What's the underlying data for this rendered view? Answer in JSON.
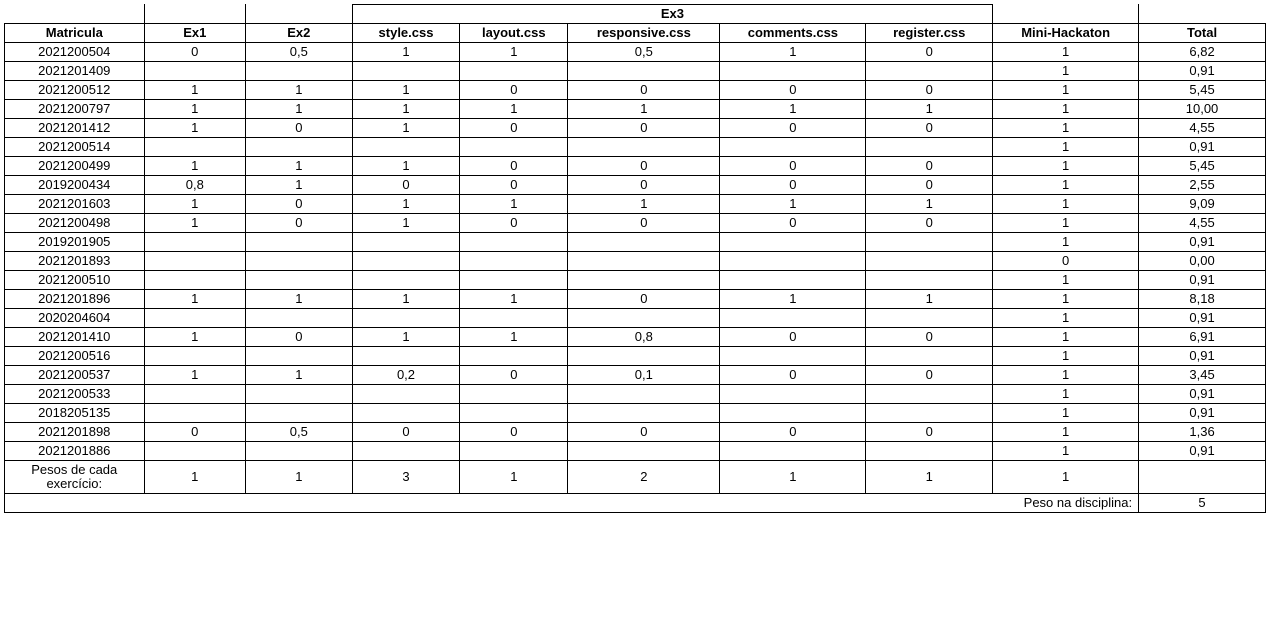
{
  "headers": {
    "group": "Ex3",
    "cols": [
      "Matricula",
      "Ex1",
      "Ex2",
      "style.css",
      "layout.css",
      "responsive.css",
      "comments.css",
      "register.css",
      "Mini-Hackaton",
      "Total"
    ]
  },
  "rows": [
    {
      "m": "2021200504",
      "v": [
        "0",
        "0,5",
        "1",
        "1",
        "0,5",
        "1",
        "0",
        "1",
        "6,82"
      ]
    },
    {
      "m": "2021201409",
      "v": [
        "",
        "",
        "",
        "",
        "",
        "",
        "",
        "1",
        "0,91"
      ]
    },
    {
      "m": "2021200512",
      "v": [
        "1",
        "1",
        "1",
        "0",
        "0",
        "0",
        "0",
        "1",
        "5,45"
      ]
    },
    {
      "m": "2021200797",
      "v": [
        "1",
        "1",
        "1",
        "1",
        "1",
        "1",
        "1",
        "1",
        "10,00"
      ]
    },
    {
      "m": "2021201412",
      "v": [
        "1",
        "0",
        "1",
        "0",
        "0",
        "0",
        "0",
        "1",
        "4,55"
      ]
    },
    {
      "m": "2021200514",
      "v": [
        "",
        "",
        "",
        "",
        "",
        "",
        "",
        "1",
        "0,91"
      ]
    },
    {
      "m": "2021200499",
      "v": [
        "1",
        "1",
        "1",
        "0",
        "0",
        "0",
        "0",
        "1",
        "5,45"
      ]
    },
    {
      "m": "2019200434",
      "v": [
        "0,8",
        "1",
        "0",
        "0",
        "0",
        "0",
        "0",
        "1",
        "2,55"
      ]
    },
    {
      "m": "2021201603",
      "v": [
        "1",
        "0",
        "1",
        "1",
        "1",
        "1",
        "1",
        "1",
        "9,09"
      ]
    },
    {
      "m": "2021200498",
      "v": [
        "1",
        "0",
        "1",
        "0",
        "0",
        "0",
        "0",
        "1",
        "4,55"
      ]
    },
    {
      "m": "2019201905",
      "v": [
        "",
        "",
        "",
        "",
        "",
        "",
        "",
        "1",
        "0,91"
      ]
    },
    {
      "m": "2021201893",
      "v": [
        "",
        "",
        "",
        "",
        "",
        "",
        "",
        "0",
        "0,00"
      ]
    },
    {
      "m": "2021200510",
      "v": [
        "",
        "",
        "",
        "",
        "",
        "",
        "",
        "1",
        "0,91"
      ]
    },
    {
      "m": "2021201896",
      "v": [
        "1",
        "1",
        "1",
        "1",
        "0",
        "1",
        "1",
        "1",
        "8,18"
      ]
    },
    {
      "m": "2020204604",
      "v": [
        "",
        "",
        "",
        "",
        "",
        "",
        "",
        "1",
        "0,91"
      ]
    },
    {
      "m": "2021201410",
      "v": [
        "1",
        "0",
        "1",
        "1",
        "0,8",
        "0",
        "0",
        "1",
        "6,91"
      ]
    },
    {
      "m": "2021200516",
      "v": [
        "",
        "",
        "",
        "",
        "",
        "",
        "",
        "1",
        "0,91"
      ]
    },
    {
      "m": "2021200537",
      "v": [
        "1",
        "1",
        "0,2",
        "0",
        "0,1",
        "0",
        "0",
        "1",
        "3,45"
      ]
    },
    {
      "m": "2021200533",
      "v": [
        "",
        "",
        "",
        "",
        "",
        "",
        "",
        "1",
        "0,91"
      ]
    },
    {
      "m": "2018205135",
      "v": [
        "",
        "",
        "",
        "",
        "",
        "",
        "",
        "1",
        "0,91"
      ]
    },
    {
      "m": "2021201898",
      "v": [
        "0",
        "0,5",
        "0",
        "0",
        "0",
        "0",
        "0",
        "1",
        "1,36"
      ]
    },
    {
      "m": "2021201886",
      "v": [
        "",
        "",
        "",
        "",
        "",
        "",
        "",
        "1",
        "0,91"
      ]
    }
  ],
  "weights": {
    "label": "Pesos de cada exercício:",
    "values": [
      "1",
      "1",
      "3",
      "1",
      "2",
      "1",
      "1",
      "1"
    ]
  },
  "footer": {
    "label": "Peso na disciplina:",
    "value": "5"
  }
}
